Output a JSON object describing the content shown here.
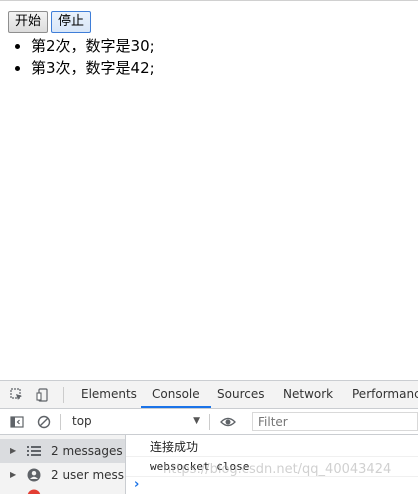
{
  "page": {
    "buttons": {
      "start": "开始",
      "stop": "停止"
    },
    "messages": [
      "第2次，数字是30;",
      "第3次，数字是42;"
    ]
  },
  "devtools": {
    "tabs": [
      "Elements",
      "Console",
      "Sources",
      "Network",
      "Performance"
    ],
    "active_tab": "Console",
    "toolbar": {
      "context": "top",
      "filter_placeholder": "Filter"
    },
    "sidebar": [
      {
        "label": "2 messages",
        "icon": "list-icon"
      },
      {
        "label": "2 user mess...",
        "icon": "user-icon"
      }
    ],
    "console_lines": [
      "连接成功",
      "websocket close"
    ]
  },
  "watermark": "https://blog.csdn.net/qq_40043424",
  "colors": {
    "accent": "#1a73e8",
    "panel_bg": "#f3f3f3",
    "border": "#cacdd1",
    "error": "#e33e33"
  }
}
